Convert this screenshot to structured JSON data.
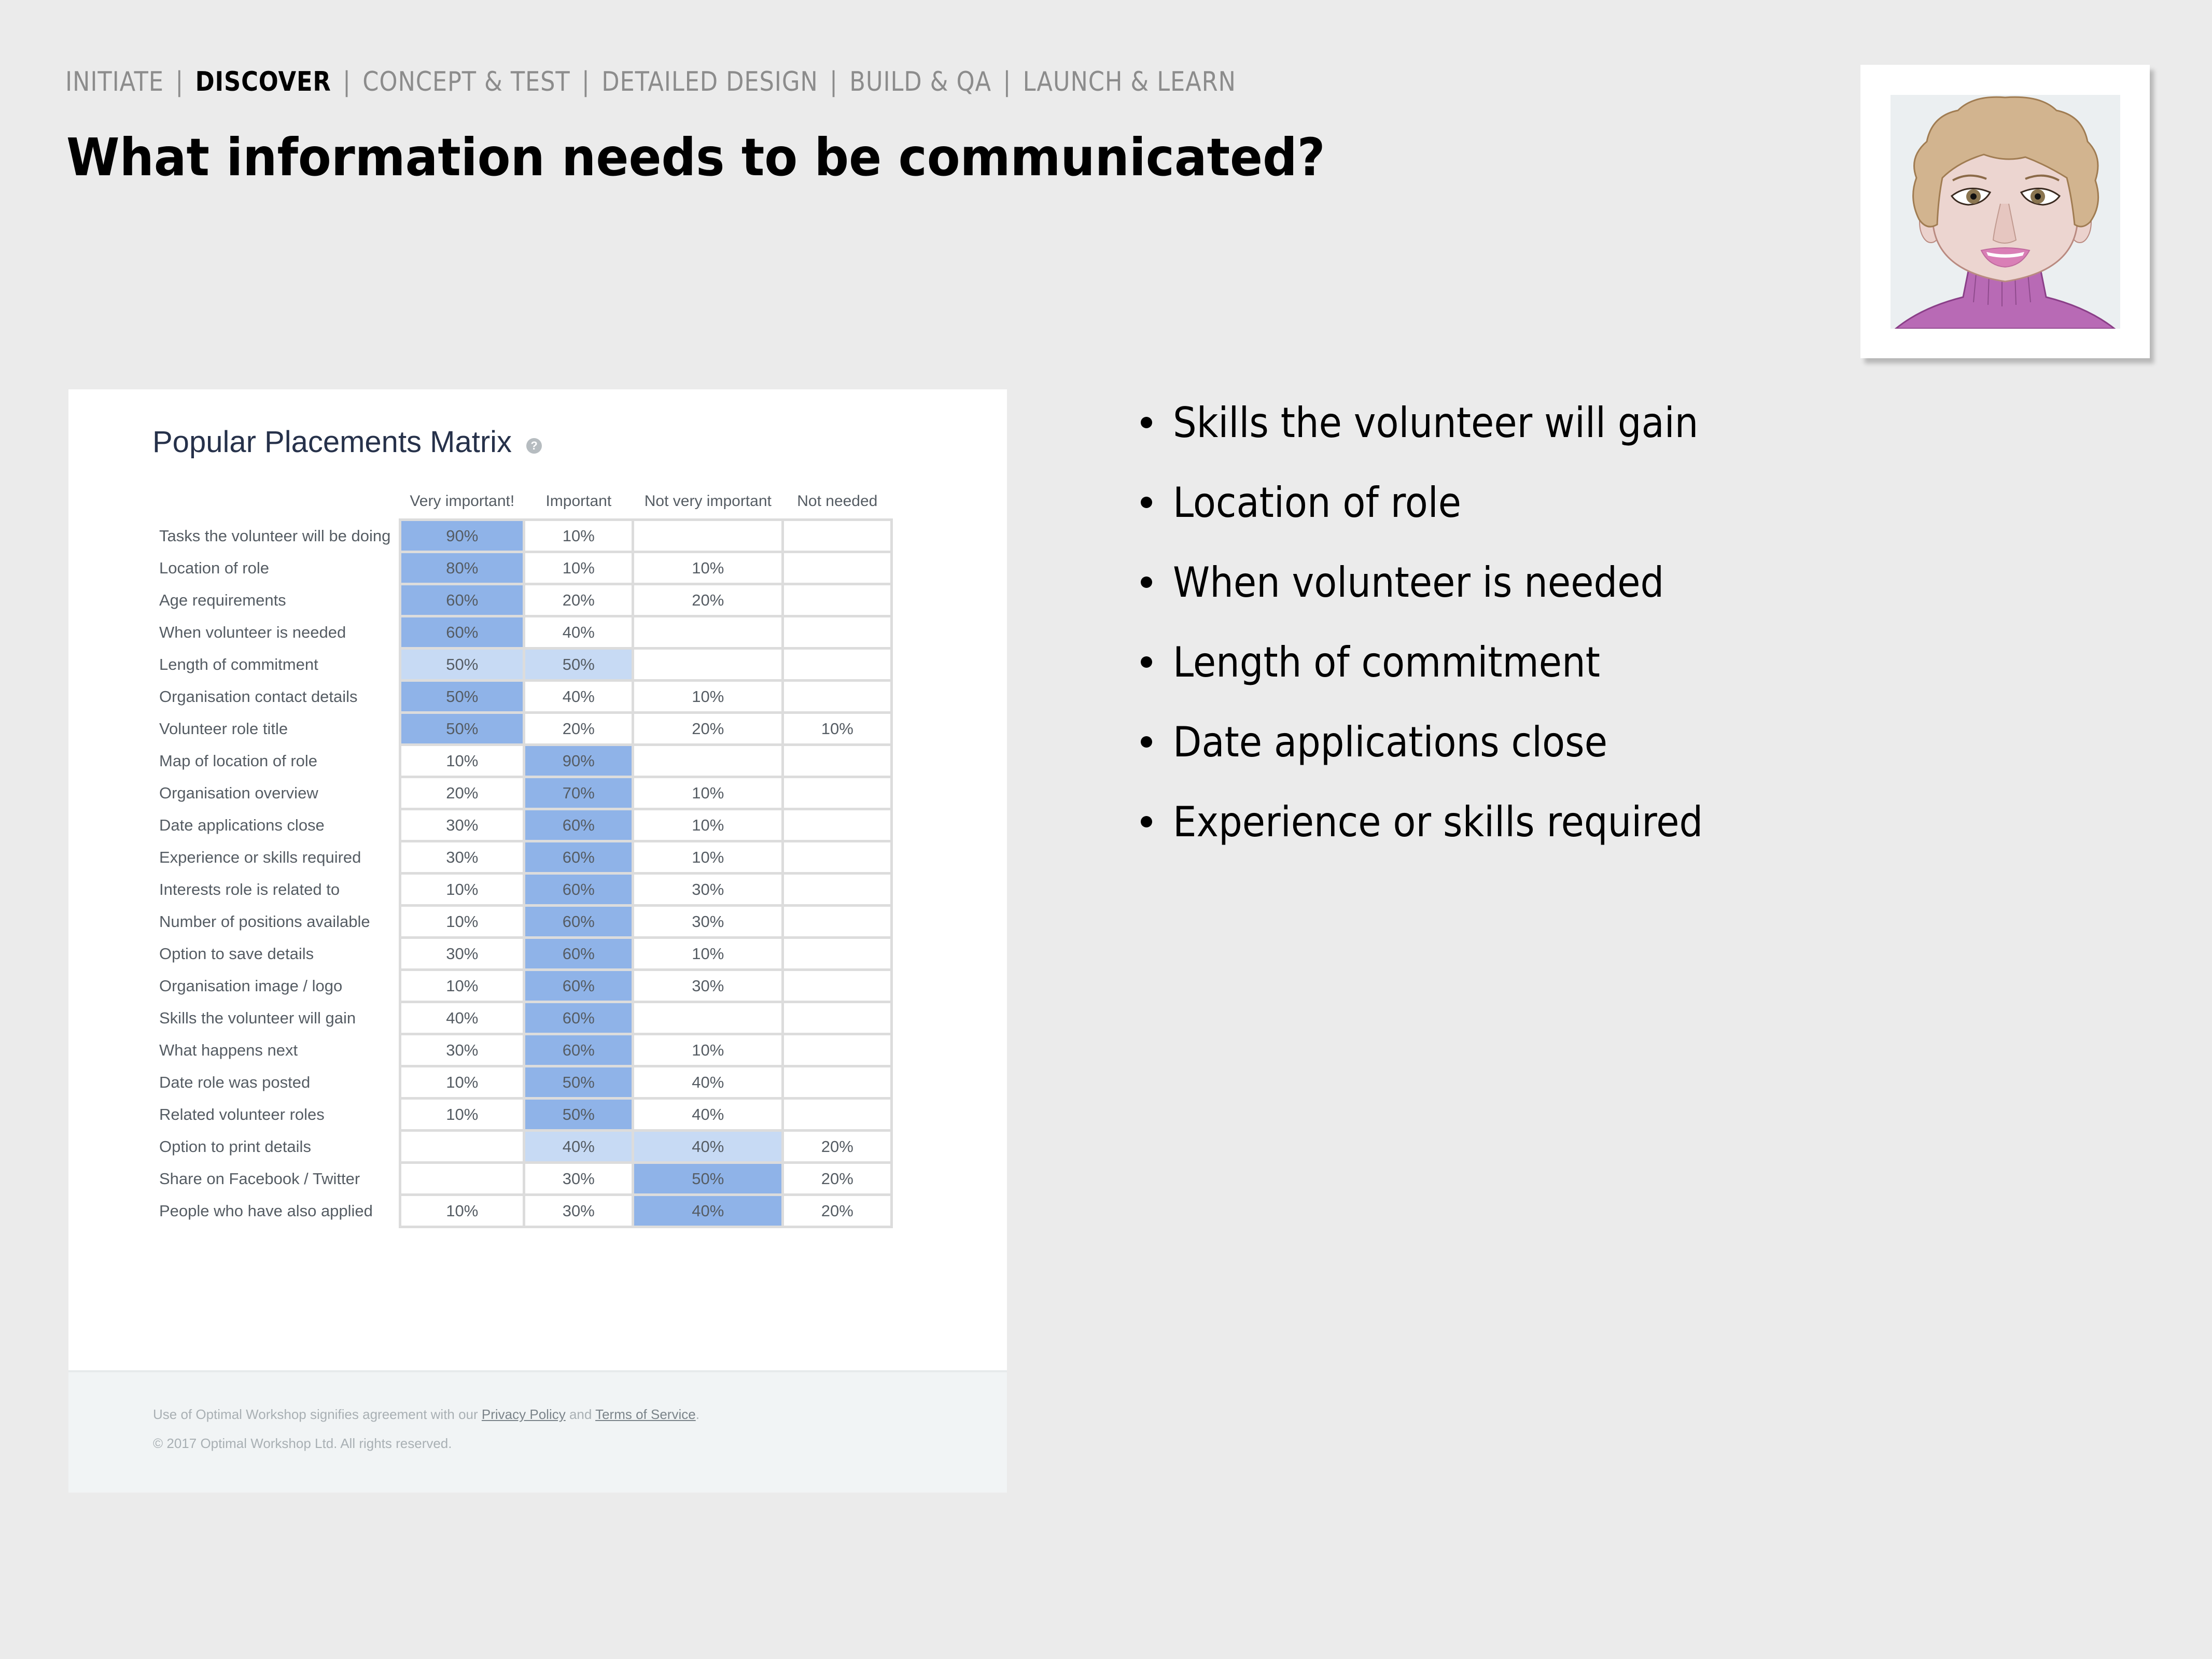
{
  "nav": {
    "steps": [
      {
        "label": "INITIATE",
        "active": false
      },
      {
        "label": "DISCOVER",
        "active": true
      },
      {
        "label": "CONCEPT & TEST",
        "active": false
      },
      {
        "label": "DETAILED DESIGN",
        "active": false
      },
      {
        "label": "BUILD & QA",
        "active": false
      },
      {
        "label": "LAUNCH & LEARN",
        "active": false
      }
    ],
    "separator": "|"
  },
  "page_title": "What information needs to be communicated?",
  "persona": {
    "icon": "avatar-woman-curly-hair-icon"
  },
  "matrix": {
    "title": "Popular Placements Matrix",
    "help_icon": "?",
    "columns": [
      "Very important!",
      "Important",
      "Not very important",
      "Not needed"
    ],
    "colors": {
      "strong": "#8fb3e8",
      "soft": "#c7daf4"
    },
    "rows": [
      {
        "label": "Tasks the volunteer will be doing",
        "values": [
          "90%",
          "10%",
          "",
          ""
        ],
        "highlight": [
          "strong",
          "",
          "",
          ""
        ]
      },
      {
        "label": "Location of role",
        "values": [
          "80%",
          "10%",
          "10%",
          ""
        ],
        "highlight": [
          "strong",
          "",
          "",
          ""
        ]
      },
      {
        "label": "Age requirements",
        "values": [
          "60%",
          "20%",
          "20%",
          ""
        ],
        "highlight": [
          "strong",
          "",
          "",
          ""
        ]
      },
      {
        "label": "When volunteer is needed",
        "values": [
          "60%",
          "40%",
          "",
          ""
        ],
        "highlight": [
          "strong",
          "",
          "",
          ""
        ]
      },
      {
        "label": "Length of commitment",
        "values": [
          "50%",
          "50%",
          "",
          ""
        ],
        "highlight": [
          "soft",
          "soft",
          "",
          ""
        ]
      },
      {
        "label": "Organisation contact details",
        "values": [
          "50%",
          "40%",
          "10%",
          ""
        ],
        "highlight": [
          "strong",
          "",
          "",
          ""
        ]
      },
      {
        "label": "Volunteer role title",
        "values": [
          "50%",
          "20%",
          "20%",
          "10%"
        ],
        "highlight": [
          "strong",
          "",
          "",
          ""
        ]
      },
      {
        "label": "Map of location of role",
        "values": [
          "10%",
          "90%",
          "",
          ""
        ],
        "highlight": [
          "",
          "strong",
          "",
          ""
        ]
      },
      {
        "label": "Organisation overview",
        "values": [
          "20%",
          "70%",
          "10%",
          ""
        ],
        "highlight": [
          "",
          "strong",
          "",
          ""
        ]
      },
      {
        "label": "Date applications close",
        "values": [
          "30%",
          "60%",
          "10%",
          ""
        ],
        "highlight": [
          "",
          "strong",
          "",
          ""
        ]
      },
      {
        "label": "Experience or skills required",
        "values": [
          "30%",
          "60%",
          "10%",
          ""
        ],
        "highlight": [
          "",
          "strong",
          "",
          ""
        ]
      },
      {
        "label": "Interests role is related to",
        "values": [
          "10%",
          "60%",
          "30%",
          ""
        ],
        "highlight": [
          "",
          "strong",
          "",
          ""
        ]
      },
      {
        "label": "Number of positions available",
        "values": [
          "10%",
          "60%",
          "30%",
          ""
        ],
        "highlight": [
          "",
          "strong",
          "",
          ""
        ]
      },
      {
        "label": "Option to save details",
        "values": [
          "30%",
          "60%",
          "10%",
          ""
        ],
        "highlight": [
          "",
          "strong",
          "",
          ""
        ]
      },
      {
        "label": "Organisation image / logo",
        "values": [
          "10%",
          "60%",
          "30%",
          ""
        ],
        "highlight": [
          "",
          "strong",
          "",
          ""
        ]
      },
      {
        "label": "Skills the volunteer will gain",
        "values": [
          "40%",
          "60%",
          "",
          ""
        ],
        "highlight": [
          "",
          "strong",
          "",
          ""
        ]
      },
      {
        "label": "What happens next",
        "values": [
          "30%",
          "60%",
          "10%",
          ""
        ],
        "highlight": [
          "",
          "strong",
          "",
          ""
        ]
      },
      {
        "label": "Date role was posted",
        "values": [
          "10%",
          "50%",
          "40%",
          ""
        ],
        "highlight": [
          "",
          "strong",
          "",
          ""
        ]
      },
      {
        "label": "Related volunteer roles",
        "values": [
          "10%",
          "50%",
          "40%",
          ""
        ],
        "highlight": [
          "",
          "strong",
          "",
          ""
        ]
      },
      {
        "label": "Option to print details",
        "values": [
          "",
          "40%",
          "40%",
          "20%"
        ],
        "highlight": [
          "",
          "soft",
          "soft",
          ""
        ]
      },
      {
        "label": "Share on Facebook / Twitter",
        "values": [
          "",
          "30%",
          "50%",
          "20%"
        ],
        "highlight": [
          "",
          "",
          "strong",
          ""
        ]
      },
      {
        "label": "People who have also applied",
        "values": [
          "10%",
          "30%",
          "40%",
          "20%"
        ],
        "highlight": [
          "",
          "",
          "strong",
          ""
        ]
      }
    ]
  },
  "footer": {
    "prefix": "Use of Optimal Workshop signifies agreement with our ",
    "privacy_link": "Privacy Policy",
    "and": " and ",
    "terms_link": "Terms of Service",
    "suffix": ".",
    "copyright": "© 2017 Optimal Workshop Ltd. All rights reserved."
  },
  "bullets": [
    "Skills the volunteer will gain",
    "Location of role",
    "When volunteer is needed",
    "Length of commitment",
    "Date applications close",
    "Experience or skills required"
  ]
}
